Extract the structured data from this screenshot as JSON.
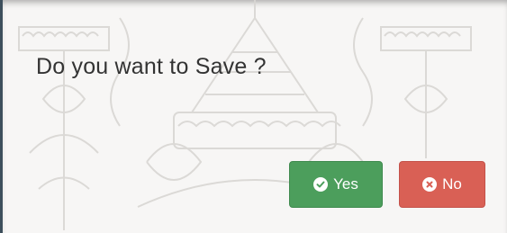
{
  "dialog": {
    "message": "Do you want to Save ?",
    "yes_label": "Yes",
    "no_label": "No"
  },
  "icons": {
    "yes": "check-circle-icon",
    "no": "times-circle-icon"
  },
  "colors": {
    "yes_button": "#4c9e5c",
    "no_button": "#d96055",
    "dialog_background": "#f7f6f5",
    "message_text": "#333333"
  }
}
